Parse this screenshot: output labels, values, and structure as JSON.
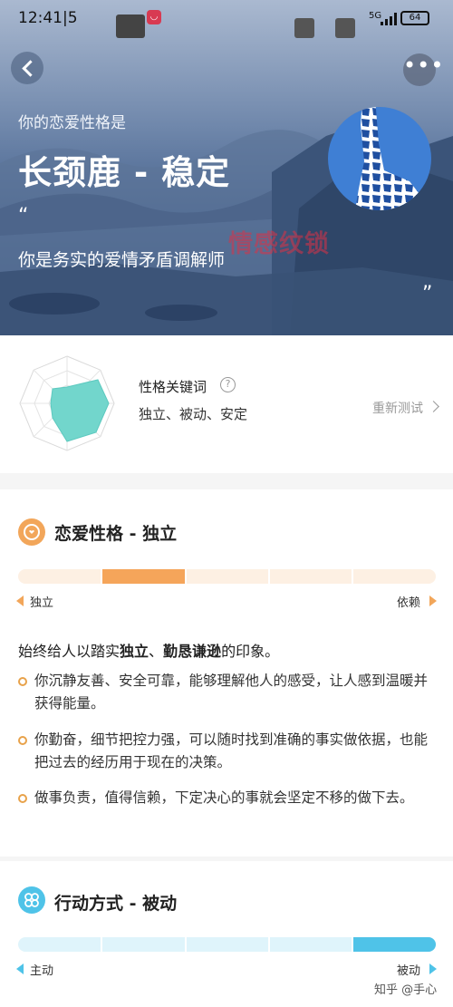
{
  "status_bar": {
    "time": "12:41",
    "time_suffix": "|5",
    "network": "5G",
    "battery": "64"
  },
  "hero": {
    "subtitle": "你的恋爱性格是",
    "title": "长颈鹿 - 稳定",
    "quote_open": "“",
    "description": "你是务实的爱情矛盾调解师",
    "quote_close": "”",
    "watermark": "情感纹锁",
    "more_label": "•••",
    "accent_color": "#3f7fd4"
  },
  "keywords": {
    "title": "性格关键词",
    "help_label": "?",
    "list": "独立、被动、安定",
    "retest_label": "重新测试",
    "radar_fill_color": "#72d6cc"
  },
  "love_section": {
    "title": "恋爱性格 - 独立",
    "icon": "heart-head-icon",
    "icon_color": "#f2a65a",
    "scale": {
      "left": "独立",
      "right": "依赖",
      "segments": 5,
      "active_segment": 2,
      "track_color": "#fdf0e3",
      "fill_color": "#f5a55a"
    },
    "summary": "始终给人以踏实独立、勤恳谦逊的印象。",
    "summary_prefix": "始终给人以踏实",
    "summary_bold1": "独立",
    "summary_mid": "、",
    "summary_bold2": "勤恳谦逊",
    "summary_suffix": "的印象。",
    "points": [
      "你沉静友善、安全可靠，能够理解他人的感受，让人感到温暖并获得能量。",
      "你勤奋，细节把控力强，可以随时找到准确的事实做依据，也能把过去的经历用于现在的决策。",
      "做事负责，值得信赖，下定决心的事就会坚定不移的做下去。"
    ],
    "bullet_color": "#e8a24a"
  },
  "action_section": {
    "title": "行动方式 - 被动",
    "icon": "clover-icon",
    "icon_color": "#4fc3e8",
    "scale": {
      "left": "主动",
      "right": "被动",
      "segments": 5,
      "active_segment": 5,
      "track_color": "#dff4fb",
      "fill_color": "#4fc3e8"
    }
  },
  "footer": {
    "watermark": "知乎 @手心"
  }
}
